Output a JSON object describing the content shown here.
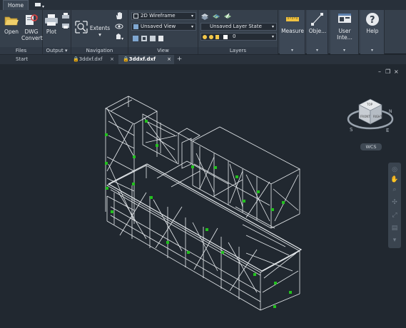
{
  "ribbon_tabs": {
    "home": "Home"
  },
  "panels": {
    "files": {
      "title": "Files",
      "open": "Open",
      "dwg_convert_1": "DWG",
      "dwg_convert_2": "Convert"
    },
    "output": {
      "title": "Output",
      "plot": "Plot"
    },
    "navigation": {
      "title": "Navigation",
      "extents": "Extents"
    },
    "view": {
      "title": "View",
      "visual_style": "2D Wireframe",
      "named_view": "Unsaved View"
    },
    "layers": {
      "title": "Layers",
      "layer_state": "Unsaved Layer State",
      "layer_name": "0"
    },
    "measure": "Measure",
    "objects": "Obje...",
    "user_interface": "User Inte...",
    "help": "Help"
  },
  "doc_tabs": {
    "start": "Start",
    "tab1": "3ddxf.dxf",
    "tab2": "3ddxf.dxf"
  },
  "viewcube": {
    "top": "TOP",
    "front": "FRONT",
    "right": "RIGHT",
    "s": "S",
    "e": "E",
    "n": "N"
  },
  "wcs": "WCS",
  "colors": {
    "ribbon": "#36404c",
    "viewport": "#212830",
    "wire": "#e8ecef",
    "grip": "#22c01e"
  }
}
